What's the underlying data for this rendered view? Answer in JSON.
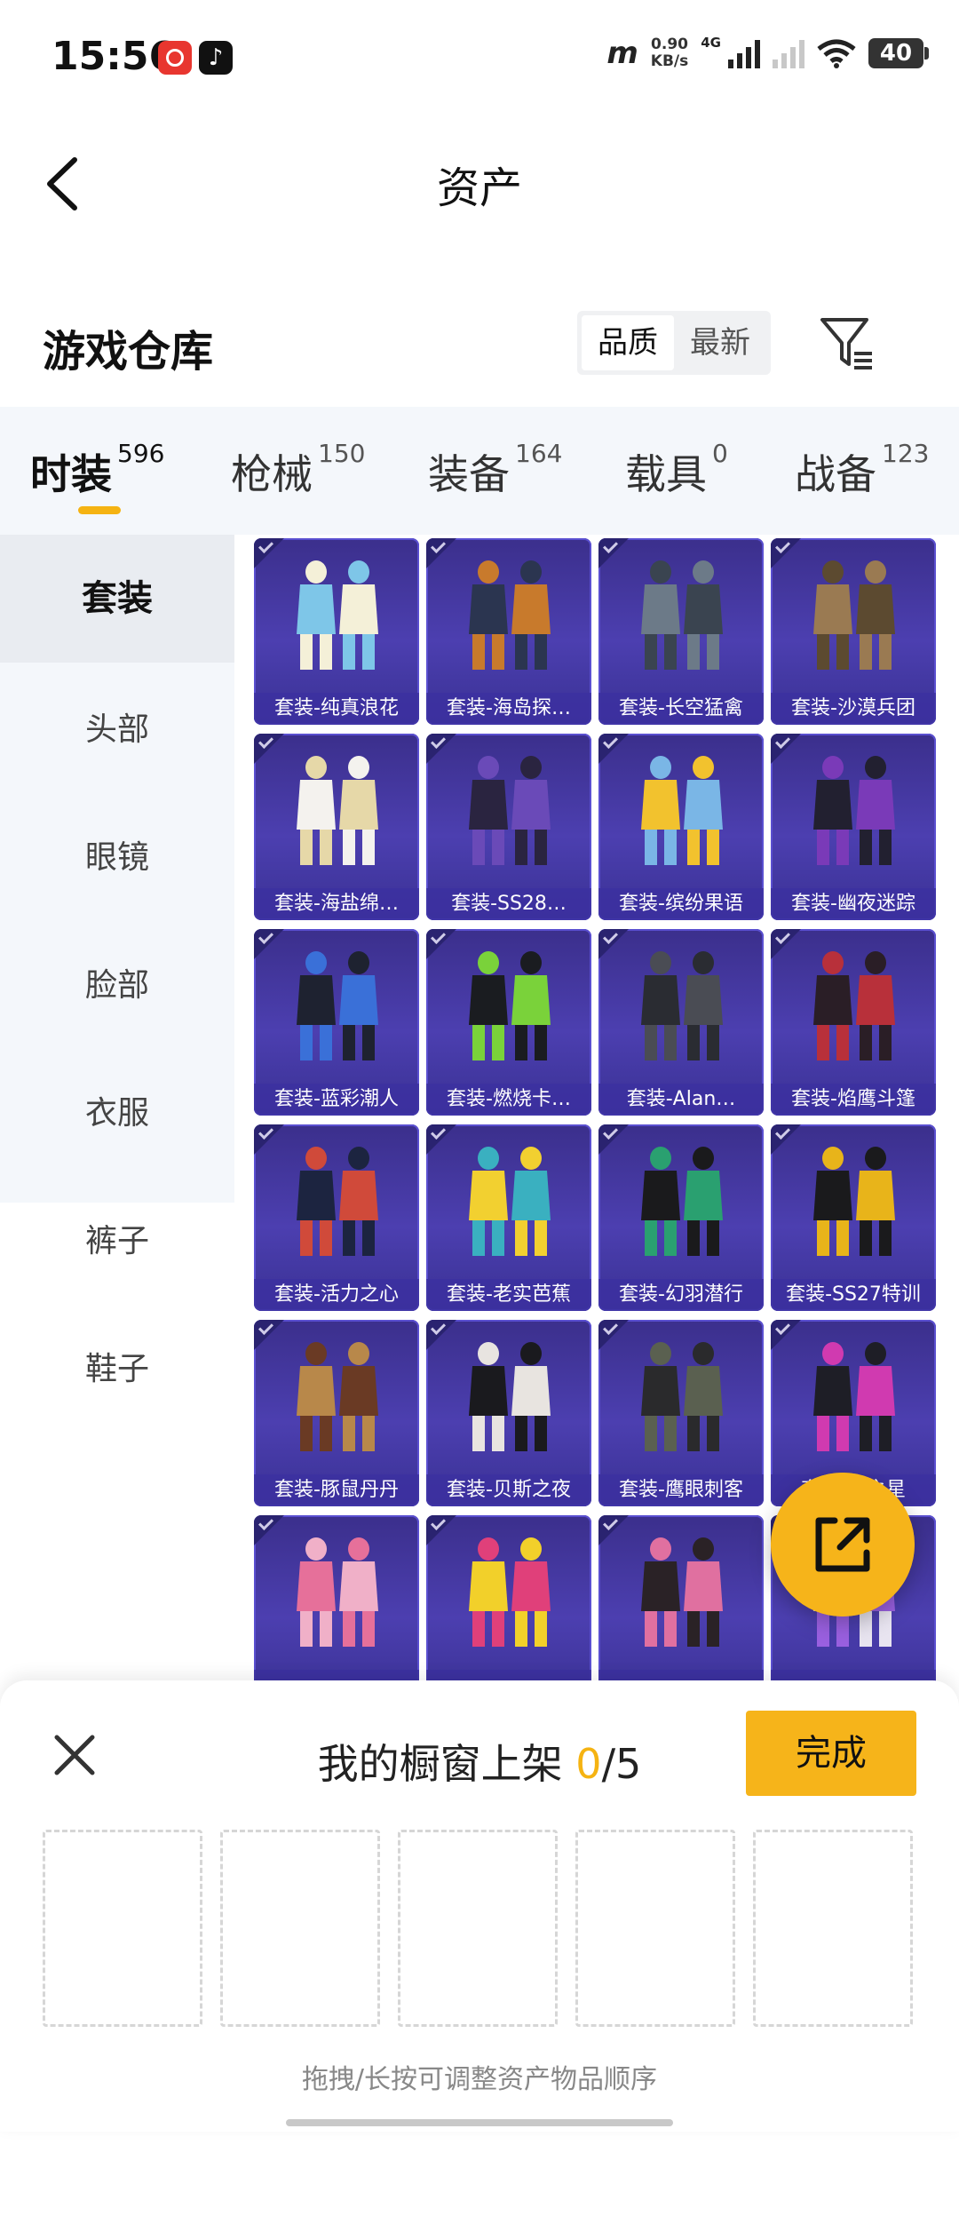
{
  "status_bar": {
    "time": "15:56",
    "speed_value": "0.90",
    "speed_unit": "KB/s",
    "network": "4G",
    "battery": "40",
    "carrier_logo": "m"
  },
  "header": {
    "title": "资产"
  },
  "section": {
    "title": "游戏仓库",
    "sort_options": [
      "品质",
      "最新"
    ]
  },
  "tabs": [
    {
      "label": "时装",
      "count": "596"
    },
    {
      "label": "枪械",
      "count": "150"
    },
    {
      "label": "装备",
      "count": "164"
    },
    {
      "label": "载具",
      "count": "0"
    },
    {
      "label": "战备",
      "count": "123"
    }
  ],
  "sidebar": {
    "items": [
      "套装",
      "头部",
      "眼镜",
      "脸部",
      "衣服",
      "裤子",
      "鞋子"
    ]
  },
  "items": [
    "套装-纯真浪花",
    "套装-海岛探…",
    "套装-长空猛禽",
    "套装-沙漠兵团",
    "套装-海盐绵…",
    "套装-SS28…",
    "套装-缤纷果语",
    "套装-幽夜迷踪",
    "套装-蓝彩潮人",
    "套装-燃烧卡…",
    "套装-Alan…",
    "套装-焰鹰斗篷",
    "套装-活力之心",
    "套装-老实芭蕉",
    "套装-幻羽潜行",
    "套装-SS27特训",
    "套装-豚鼠丹丹",
    "套装-贝斯之夜",
    "套装-鹰眼刺客",
    "套装-…之星",
    "",
    "",
    "",
    ""
  ],
  "item_colors": [
    [
      "#7ec6e8",
      "#f4f0d8"
    ],
    [
      "#2b3550",
      "#c87a2c"
    ],
    [
      "#6c7a88",
      "#3a4450"
    ],
    [
      "#9a7a52",
      "#5c4a30"
    ],
    [
      "#f4f2ee",
      "#e6d8a8"
    ],
    [
      "#2a2440",
      "#6a4ab8"
    ],
    [
      "#f2c22e",
      "#7ab6e6"
    ],
    [
      "#222030",
      "#7a3ab8"
    ],
    [
      "#1e2230",
      "#3a70d8"
    ],
    [
      "#1a1c20",
      "#7ad23a"
    ],
    [
      "#2a2c32",
      "#4a4c54"
    ],
    [
      "#2a1e26",
      "#b8303a"
    ],
    [
      "#1c2440",
      "#d04a3a"
    ],
    [
      "#f2d030",
      "#3ab0c0"
    ],
    [
      "#1a1a1c",
      "#2aa070"
    ],
    [
      "#1a1a1c",
      "#e8b41a"
    ],
    [
      "#b8884a",
      "#6a3a24"
    ],
    [
      "#1a1a1e",
      "#e8e4e0"
    ],
    [
      "#2a2a2c",
      "#5a6050"
    ],
    [
      "#1e1e26",
      "#d03ab0"
    ],
    [
      "#e6709a",
      "#f0b0c8"
    ],
    [
      "#f2d02a",
      "#e0407a"
    ],
    [
      "#2a2226",
      "#e070a0"
    ],
    [
      "#e8e4f0",
      "#9a60e0"
    ]
  ],
  "sheet": {
    "title_prefix": "我的橱窗上架",
    "count": "0",
    "total": "/5",
    "done_label": "完成",
    "hint": "拖拽/长按可调整资产物品顺序",
    "slots": 5
  }
}
